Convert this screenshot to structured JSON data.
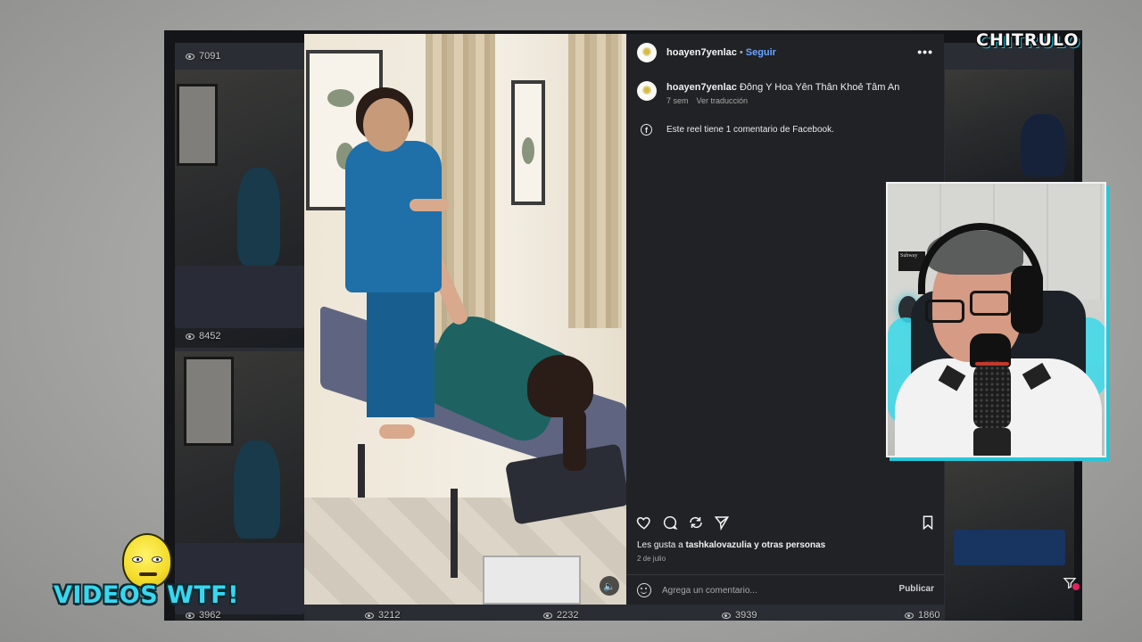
{
  "backdrop": {
    "view_counts": [
      "7091",
      "8452",
      "3962",
      "3212",
      "2232",
      "3939",
      "1860"
    ]
  },
  "post": {
    "username": "hoayen7yenlac",
    "separator": "•",
    "follow_label": "Seguir",
    "more_label": "•••",
    "caption_username": "hoayen7yenlac",
    "caption_text": "Đông Y Hoa Yên Thân Khoẻ Tâm An",
    "caption_age": "7 sem",
    "translate_label": "Ver traducción",
    "fb_icon_letter": "f",
    "facebook_note": "Este reel tiene 1 comentario de Facebook.",
    "likes_prefix": "Les gusta a ",
    "likes_user": "tashkalovazulia",
    "likes_suffix": " y otras personas",
    "date": "2 de julio",
    "comment_placeholder": "Agrega un comentario...",
    "publish_label": "Publicar"
  },
  "video": {
    "sound_icon": "🔈"
  },
  "overlay": {
    "channel_logo": "CHITRULO",
    "segment_title": "VIDEOS WTF!",
    "cam_sign": "Subway"
  },
  "icons": {
    "like": "heart-icon",
    "comment": "comment-bubble-icon",
    "repost": "repost-icon",
    "share": "send-icon",
    "save": "bookmark-icon"
  },
  "colors": {
    "follow_blue": "#6aa4ff",
    "panel_bg": "#202226",
    "accent_cyan": "#29c6d9",
    "wtf_cyan": "#38d7ef"
  }
}
